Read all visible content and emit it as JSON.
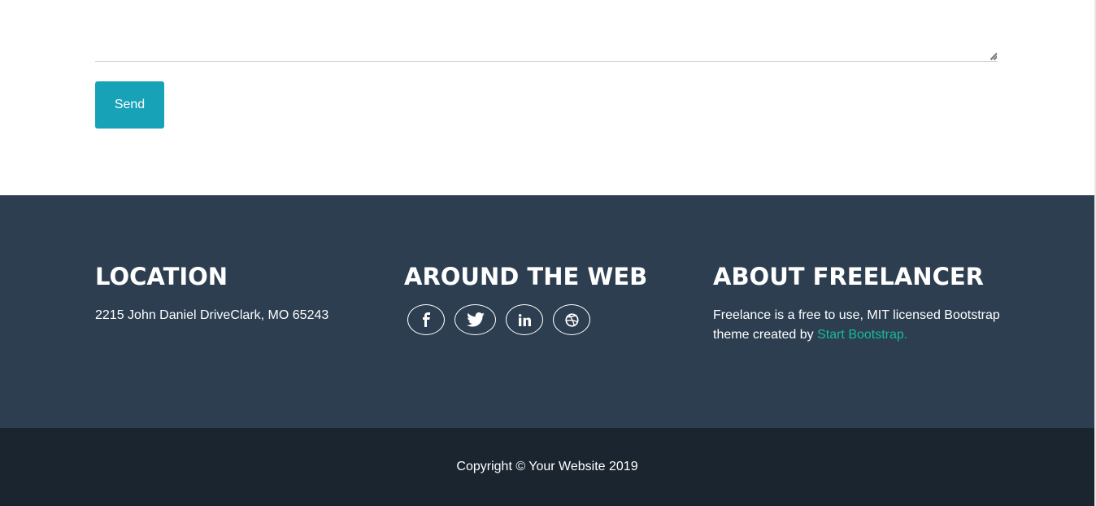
{
  "form": {
    "message_value": "",
    "message_placeholder": "",
    "send_label": "Send"
  },
  "footer": {
    "location": {
      "heading": "LOCATION",
      "address": "2215 John Daniel DriveClark, MO 65243"
    },
    "around_web": {
      "heading": "AROUND THE WEB",
      "icons": [
        "facebook-icon",
        "twitter-icon",
        "linkedin-icon",
        "dribbble-icon"
      ]
    },
    "about": {
      "heading": "ABOUT FREELANCER",
      "text": "Freelance is a free to use, MIT licensed Bootstrap theme created by",
      "link_text": "Start Bootstrap."
    }
  },
  "copyright": {
    "text": "Copyright © Your Website 2019"
  },
  "colors": {
    "primary_button": "#18a2b8",
    "footer_bg": "#2c3e50",
    "copyright_bg": "#1a252f",
    "link": "#18bc9c"
  }
}
